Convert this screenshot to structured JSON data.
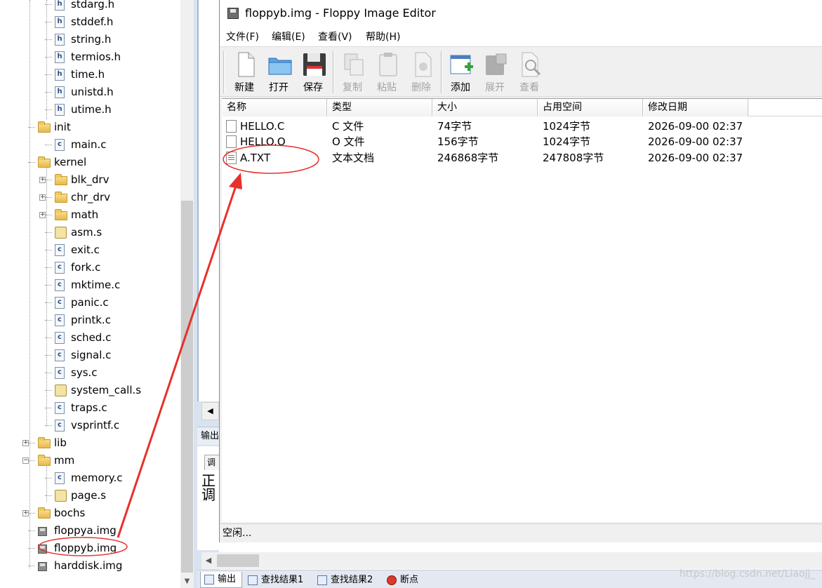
{
  "tree": {
    "items": [
      {
        "label": "stdarg.h",
        "type": "h",
        "indent": 3
      },
      {
        "label": "stddef.h",
        "type": "h",
        "indent": 3
      },
      {
        "label": "string.h",
        "type": "h",
        "indent": 3
      },
      {
        "label": "termios.h",
        "type": "h",
        "indent": 3
      },
      {
        "label": "time.h",
        "type": "h",
        "indent": 3
      },
      {
        "label": "unistd.h",
        "type": "h",
        "indent": 3
      },
      {
        "label": "utime.h",
        "type": "h",
        "indent": 3
      },
      {
        "label": "init",
        "type": "folder-open",
        "indent": 2
      },
      {
        "label": "main.c",
        "type": "c",
        "indent": 3
      },
      {
        "label": "kernel",
        "type": "folder-open",
        "indent": 2
      },
      {
        "label": "blk_drv",
        "type": "folder",
        "indent": 3,
        "expander": "+"
      },
      {
        "label": "chr_drv",
        "type": "folder",
        "indent": 3,
        "expander": "+"
      },
      {
        "label": "math",
        "type": "folder",
        "indent": 3,
        "expander": "+"
      },
      {
        "label": "asm.s",
        "type": "s",
        "indent": 3
      },
      {
        "label": "exit.c",
        "type": "c",
        "indent": 3
      },
      {
        "label": "fork.c",
        "type": "c",
        "indent": 3
      },
      {
        "label": "mktime.c",
        "type": "c",
        "indent": 3
      },
      {
        "label": "panic.c",
        "type": "c",
        "indent": 3
      },
      {
        "label": "printk.c",
        "type": "c",
        "indent": 3
      },
      {
        "label": "sched.c",
        "type": "c",
        "indent": 3
      },
      {
        "label": "signal.c",
        "type": "c",
        "indent": 3
      },
      {
        "label": "sys.c",
        "type": "c",
        "indent": 3
      },
      {
        "label": "system_call.s",
        "type": "s",
        "indent": 3
      },
      {
        "label": "traps.c",
        "type": "c",
        "indent": 3
      },
      {
        "label": "vsprintf.c",
        "type": "c",
        "indent": 3
      },
      {
        "label": "lib",
        "type": "folder",
        "indent": 2,
        "expander": "+"
      },
      {
        "label": "mm",
        "type": "folder-open",
        "indent": 2,
        "expander": "-"
      },
      {
        "label": "memory.c",
        "type": "c",
        "indent": 3
      },
      {
        "label": "page.s",
        "type": "s",
        "indent": 3
      },
      {
        "label": "bochs",
        "type": "folder",
        "indent": 2,
        "expander": "+"
      },
      {
        "label": "floppya.img",
        "type": "disk",
        "indent": 2
      },
      {
        "label": "floppyb.img",
        "type": "disk",
        "indent": 2
      },
      {
        "label": "harddisk.img",
        "type": "disk",
        "indent": 2
      }
    ]
  },
  "editor": {
    "title": "floppyb.img - Floppy Image Editor",
    "menu": [
      "文件(F)",
      "编辑(E)",
      "查看(V)",
      "帮助(H)"
    ],
    "toolbar": [
      {
        "label": "新建",
        "icon": "new-file-icon",
        "enabled": true
      },
      {
        "label": "打开",
        "icon": "open-folder-icon",
        "enabled": true
      },
      {
        "label": "保存",
        "icon": "save-icon",
        "enabled": true
      },
      {
        "label": "复制",
        "icon": "copy-icon",
        "enabled": false
      },
      {
        "label": "粘贴",
        "icon": "paste-icon",
        "enabled": false
      },
      {
        "label": "删除",
        "icon": "delete-icon",
        "enabled": false
      },
      {
        "label": "添加",
        "icon": "add-icon",
        "enabled": true
      },
      {
        "label": "展开",
        "icon": "extract-icon",
        "enabled": false
      },
      {
        "label": "查看",
        "icon": "view-icon",
        "enabled": false
      }
    ],
    "columns": [
      "名称",
      "类型",
      "大小",
      "占用空间",
      "修改日期"
    ],
    "files": [
      {
        "name": "HELLO.C",
        "type": "C 文件",
        "size": "74字节",
        "space": "1024字节",
        "date": "2026-09-00 02:37",
        "icon": "file-icon"
      },
      {
        "name": "HELLO.O",
        "type": "O 文件",
        "size": "156字节",
        "space": "1024字节",
        "date": "2026-09-00 02:37",
        "icon": "file-icon"
      },
      {
        "name": "A.TXT",
        "type": "文本文档",
        "size": "246868字节",
        "space": "247808字节",
        "date": "2026-09-00 02:37",
        "icon": "text-file-icon"
      }
    ],
    "status": "空闲..."
  },
  "ide": {
    "output_header": "输出",
    "output_tab": "调",
    "output_lines": [
      "正",
      "调"
    ],
    "bottom_tabs": [
      "输出",
      "查找结果1",
      "查找结果2",
      "断点"
    ],
    "watermark": "https://blog.csdn.net/Liaojj_"
  },
  "colors": {
    "annotation": "#e8302a"
  }
}
